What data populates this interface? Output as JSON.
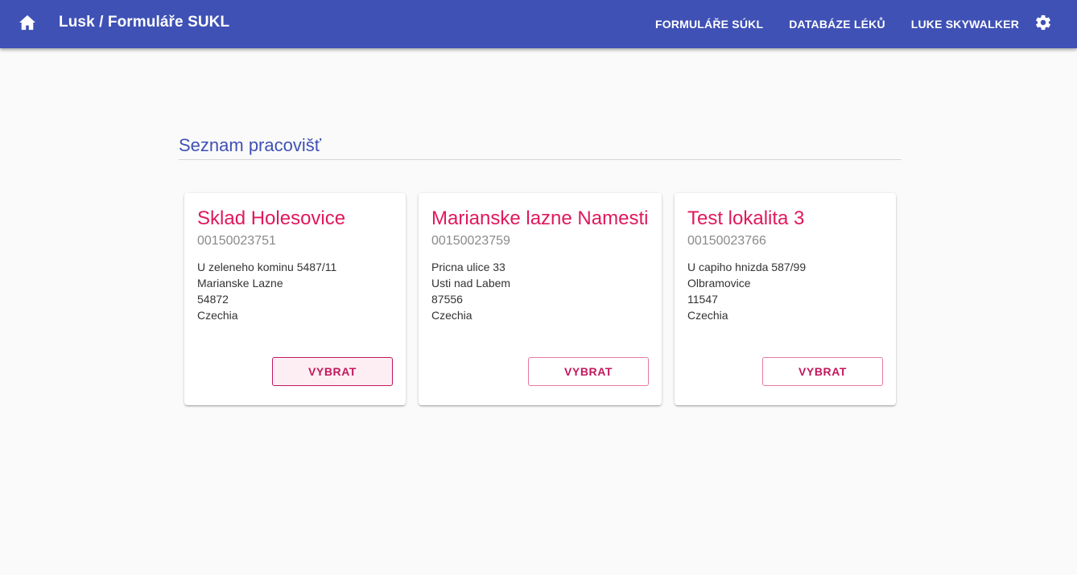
{
  "header": {
    "title": "Lusk / Formuláře SUKL",
    "home_icon": "home-icon",
    "nav": [
      {
        "label": "Formuláře SÚKL"
      },
      {
        "label": "Databáze léků"
      },
      {
        "label": "Luke Skywalker"
      }
    ],
    "settings_icon": "gear-icon",
    "color": "#3f51b5"
  },
  "main": {
    "title": "Seznam pracovišť",
    "title_color": "#3f51b5",
    "accent_color": "#e0185d",
    "cards": [
      {
        "name": "Sklad Holesovice",
        "code": "00150023751",
        "street": "U zeleneho kominu 5487/11",
        "city": "Marianske Lazne",
        "zip": "54872",
        "country": "Czechia",
        "button": "Vybrat"
      },
      {
        "name": "Marianske lazne Namesti",
        "code": "00150023759",
        "street": "Pricna ulice 33",
        "city": "Usti nad Labem",
        "zip": "87556",
        "country": "Czechia",
        "button": "Vybrat"
      },
      {
        "name": "Test lokalita 3",
        "code": "00150023766",
        "street": "U capiho hnizda 587/99",
        "city": "Olbramovice",
        "zip": "11547",
        "country": "Czechia",
        "button": "Vybrat"
      }
    ]
  }
}
